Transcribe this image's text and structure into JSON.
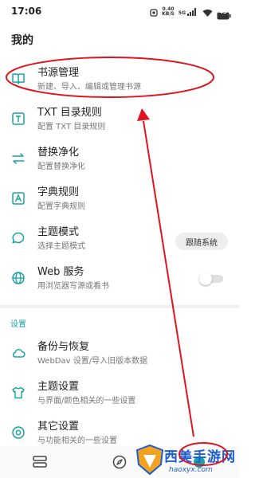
{
  "status_bar": {
    "time": "17:06",
    "net_speed_value": "0.40",
    "net_speed_unit": "KB/S",
    "signal_label": "5G",
    "battery_level": "43"
  },
  "page_title": "我的",
  "menu": [
    {
      "title": "书源管理",
      "subtitle": "新建、导入、编辑或管理书源",
      "icon": "book-source-icon"
    },
    {
      "title": "TXT 目录规则",
      "subtitle": "配置 TXT 目录规则",
      "icon": "txt-icon"
    },
    {
      "title": "替换净化",
      "subtitle": "配置替换净化",
      "icon": "swap-icon"
    },
    {
      "title": "字典规则",
      "subtitle": "配置字典规则",
      "icon": "dictionary-icon"
    },
    {
      "title": "主题模式",
      "subtitle": "选择主题模式",
      "icon": "chat-bubble-icon"
    },
    {
      "title": "Web 服务",
      "subtitle": "用浏览器写源或看书",
      "icon": "globe-icon"
    }
  ],
  "theme_mode_value": "跟随系统",
  "web_service_enabled": false,
  "settings_section_label": "设置",
  "settings": [
    {
      "title": "备份与恢复",
      "subtitle": "WebDav 设置/导入旧版本数据",
      "icon": "cloud-icon"
    },
    {
      "title": "主题设置",
      "subtitle": "与界面/颜色相关的一些设置",
      "icon": "tshirt-icon"
    },
    {
      "title": "其它设置",
      "subtitle": "与功能相关的一些设置",
      "icon": "settings-circle-icon"
    }
  ],
  "watermark": {
    "text": "西美手游网",
    "domain": "haoxyx.com"
  },
  "colors": {
    "accent": "#18a2a6",
    "annotation": "#e0141e",
    "watermark": "#1b5ed6"
  }
}
